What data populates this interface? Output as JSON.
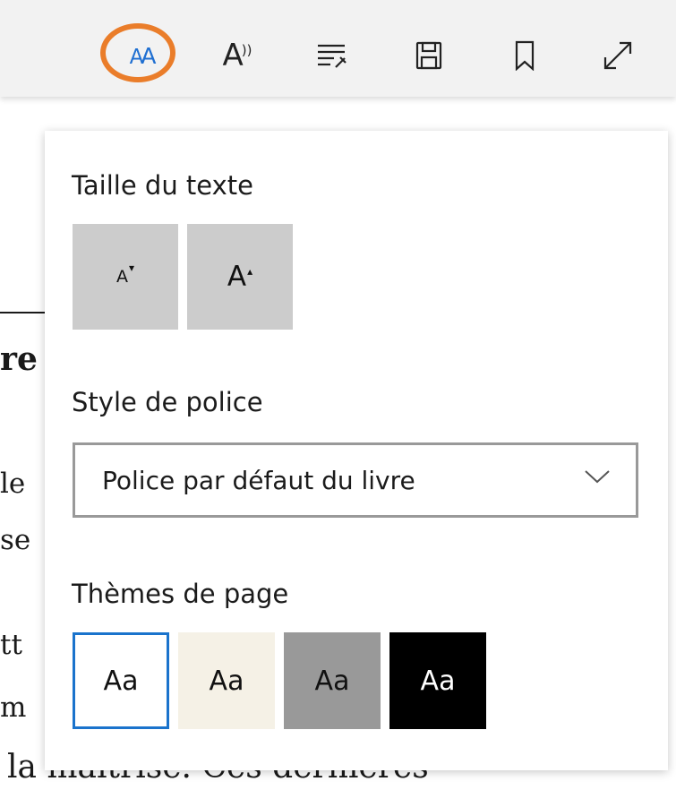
{
  "toolbar": {
    "icons": [
      "text-options-icon",
      "read-aloud-icon",
      "grammar-tools-icon",
      "save-icon",
      "bookmark-icon",
      "fullscreen-icon"
    ],
    "text_options_glyph_small": "A",
    "text_options_glyph_large": "A",
    "read_aloud_glyph": "A",
    "read_aloud_sound": "))",
    "highlight_color": "#ea7d2a",
    "accent_color": "#1f6fd1"
  },
  "background_text": {
    "heading": "re",
    "line1": "le",
    "line2": "se",
    "line3": "tt",
    "line4": "m",
    "line5": "la  maîtrise.  Ces  dernières"
  },
  "panel": {
    "text_size": {
      "label": "Taille du texte",
      "decrease_glyph": "A",
      "increase_glyph": "A"
    },
    "font_style": {
      "label": "Style de police",
      "selected": "Police par défaut du livre"
    },
    "page_themes": {
      "label": "Thèmes de page",
      "sample": "Aa",
      "themes": [
        {
          "name": "white",
          "bg": "#ffffff",
          "selected": true
        },
        {
          "name": "sepia",
          "bg": "#f5f1e6",
          "selected": false
        },
        {
          "name": "gray",
          "bg": "#999999",
          "selected": false
        },
        {
          "name": "dark",
          "bg": "#000000",
          "selected": false
        }
      ]
    }
  }
}
